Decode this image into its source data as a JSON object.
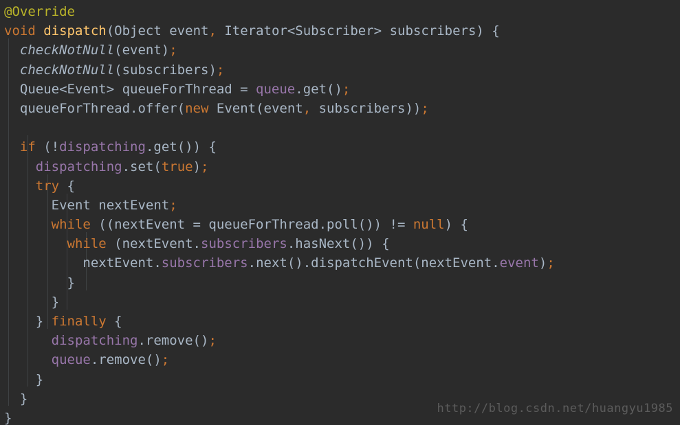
{
  "editor": {
    "background_color": "#2b2b2b",
    "guide_color": "#3f4244",
    "language": "java",
    "colors": {
      "annotation": "#bbb529",
      "keyword": "#cc7832",
      "method_declaration": "#ffc66d",
      "plain_text": "#a9b7c6",
      "field": "#9876aa",
      "static_method": "#a9b7c6",
      "watermark": "#5c5c5c"
    }
  },
  "code": {
    "lines": [
      {
        "number": 1,
        "indent": 0,
        "text": "@Override",
        "tokens": [
          {
            "t": "@Override",
            "c": "anno"
          }
        ]
      },
      {
        "number": 2,
        "indent": 0,
        "text": "void dispatch(Object event, Iterator<Subscriber> subscribers) {",
        "tokens": [
          {
            "t": "void",
            "c": "kw"
          },
          {
            "t": " ",
            "c": "plain"
          },
          {
            "t": "dispatch",
            "c": "method"
          },
          {
            "t": "(Object event",
            "c": "plain"
          },
          {
            "t": ",",
            "c": "comma"
          },
          {
            "t": " Iterator<Subscriber> subscribers) {",
            "c": "plain"
          }
        ]
      },
      {
        "number": 3,
        "indent": 2,
        "text": "  checkNotNull(event);",
        "tokens": [
          {
            "t": "  ",
            "c": "plain"
          },
          {
            "t": "checkNotNull",
            "c": "static"
          },
          {
            "t": "(event)",
            "c": "plain"
          },
          {
            "t": ";",
            "c": "semi"
          }
        ]
      },
      {
        "number": 4,
        "indent": 2,
        "text": "  checkNotNull(subscribers);",
        "tokens": [
          {
            "t": "  ",
            "c": "plain"
          },
          {
            "t": "checkNotNull",
            "c": "static"
          },
          {
            "t": "(subscribers)",
            "c": "plain"
          },
          {
            "t": ";",
            "c": "semi"
          }
        ]
      },
      {
        "number": 5,
        "indent": 2,
        "text": "  Queue<Event> queueForThread = queue.get();",
        "tokens": [
          {
            "t": "  Queue<Event> queueForThread = ",
            "c": "plain"
          },
          {
            "t": "queue",
            "c": "field"
          },
          {
            "t": ".get()",
            "c": "plain"
          },
          {
            "t": ";",
            "c": "semi"
          }
        ]
      },
      {
        "number": 6,
        "indent": 2,
        "text": "  queueForThread.offer(new Event(event, subscribers));",
        "tokens": [
          {
            "t": "  queueForThread.offer(",
            "c": "plain"
          },
          {
            "t": "new",
            "c": "kw"
          },
          {
            "t": " Event(event",
            "c": "plain"
          },
          {
            "t": ",",
            "c": "comma"
          },
          {
            "t": " subscribers))",
            "c": "plain"
          },
          {
            "t": ";",
            "c": "semi"
          }
        ]
      },
      {
        "number": 7,
        "indent": 0,
        "text": "",
        "tokens": []
      },
      {
        "number": 8,
        "indent": 2,
        "text": "  if (!dispatching.get()) {",
        "tokens": [
          {
            "t": "  ",
            "c": "plain"
          },
          {
            "t": "if",
            "c": "kw"
          },
          {
            "t": " (!",
            "c": "plain"
          },
          {
            "t": "dispatching",
            "c": "field"
          },
          {
            "t": ".get()) {",
            "c": "plain"
          }
        ]
      },
      {
        "number": 9,
        "indent": 4,
        "text": "    dispatching.set(true);",
        "tokens": [
          {
            "t": "    ",
            "c": "plain"
          },
          {
            "t": "dispatching",
            "c": "field"
          },
          {
            "t": ".set(",
            "c": "plain"
          },
          {
            "t": "true",
            "c": "kw"
          },
          {
            "t": ")",
            "c": "plain"
          },
          {
            "t": ";",
            "c": "semi"
          }
        ]
      },
      {
        "number": 10,
        "indent": 4,
        "text": "    try {",
        "tokens": [
          {
            "t": "    ",
            "c": "plain"
          },
          {
            "t": "try",
            "c": "kw"
          },
          {
            "t": " {",
            "c": "plain"
          }
        ]
      },
      {
        "number": 11,
        "indent": 6,
        "text": "      Event nextEvent;",
        "tokens": [
          {
            "t": "      Event nextEvent",
            "c": "plain"
          },
          {
            "t": ";",
            "c": "semi"
          }
        ]
      },
      {
        "number": 12,
        "indent": 6,
        "text": "      while ((nextEvent = queueForThread.poll()) != null) {",
        "tokens": [
          {
            "t": "      ",
            "c": "plain"
          },
          {
            "t": "while",
            "c": "kw"
          },
          {
            "t": " ((nextEvent = queueForThread.poll()) != ",
            "c": "plain"
          },
          {
            "t": "null",
            "c": "kw"
          },
          {
            "t": ") {",
            "c": "plain"
          }
        ]
      },
      {
        "number": 13,
        "indent": 8,
        "text": "        while (nextEvent.subscribers.hasNext()) {",
        "tokens": [
          {
            "t": "        ",
            "c": "plain"
          },
          {
            "t": "while",
            "c": "kw"
          },
          {
            "t": " (nextEvent.",
            "c": "plain"
          },
          {
            "t": "subscribers",
            "c": "field"
          },
          {
            "t": ".hasNext()) {",
            "c": "plain"
          }
        ]
      },
      {
        "number": 14,
        "indent": 10,
        "text": "          nextEvent.subscribers.next().dispatchEvent(nextEvent.event);",
        "tokens": [
          {
            "t": "          nextEvent.",
            "c": "plain"
          },
          {
            "t": "subscribers",
            "c": "field"
          },
          {
            "t": ".next().dispatchEvent(nextEvent.",
            "c": "plain"
          },
          {
            "t": "event",
            "c": "field"
          },
          {
            "t": ")",
            "c": "plain"
          },
          {
            "t": ";",
            "c": "semi"
          }
        ]
      },
      {
        "number": 15,
        "indent": 8,
        "text": "        }",
        "tokens": [
          {
            "t": "        }",
            "c": "plain"
          }
        ]
      },
      {
        "number": 16,
        "indent": 6,
        "text": "      }",
        "tokens": [
          {
            "t": "      }",
            "c": "plain"
          }
        ]
      },
      {
        "number": 17,
        "indent": 4,
        "text": "    } finally {",
        "tokens": [
          {
            "t": "    } ",
            "c": "plain"
          },
          {
            "t": "finally",
            "c": "kw"
          },
          {
            "t": " {",
            "c": "plain"
          }
        ]
      },
      {
        "number": 18,
        "indent": 6,
        "text": "      dispatching.remove();",
        "tokens": [
          {
            "t": "      ",
            "c": "plain"
          },
          {
            "t": "dispatching",
            "c": "field"
          },
          {
            "t": ".remove()",
            "c": "plain"
          },
          {
            "t": ";",
            "c": "semi"
          }
        ]
      },
      {
        "number": 19,
        "indent": 6,
        "text": "      queue.remove();",
        "tokens": [
          {
            "t": "      ",
            "c": "plain"
          },
          {
            "t": "queue",
            "c": "field"
          },
          {
            "t": ".remove()",
            "c": "plain"
          },
          {
            "t": ";",
            "c": "semi"
          }
        ]
      },
      {
        "number": 20,
        "indent": 4,
        "text": "    }",
        "tokens": [
          {
            "t": "    }",
            "c": "plain"
          }
        ]
      },
      {
        "number": 21,
        "indent": 2,
        "text": "  }",
        "tokens": [
          {
            "t": "  }",
            "c": "plain"
          }
        ]
      },
      {
        "number": 22,
        "indent": 0,
        "text": "}",
        "tokens": [
          {
            "t": "}",
            "c": "plain"
          }
        ]
      }
    ]
  },
  "watermark": {
    "text": "http://blog.csdn.net/huangyu1985"
  }
}
